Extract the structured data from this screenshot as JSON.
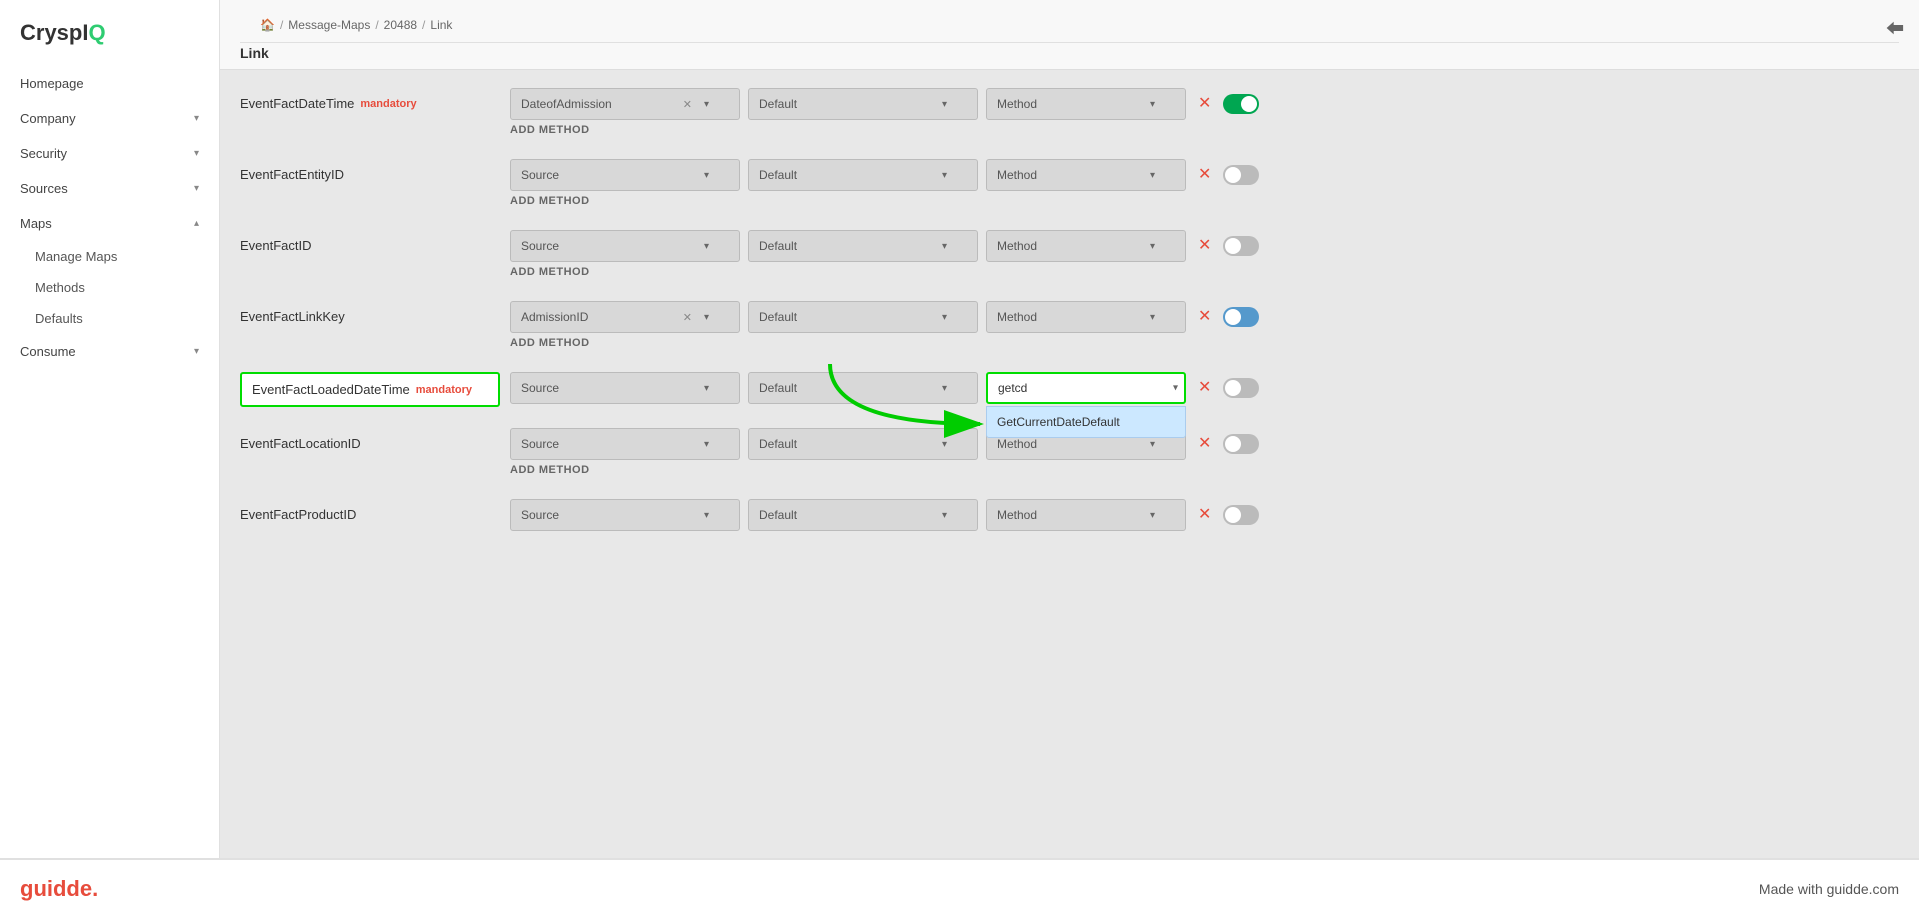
{
  "app": {
    "logo_crys": "CryspI",
    "logo_q": "Q",
    "logout_icon": "→"
  },
  "breadcrumb": {
    "home_icon": "🏠",
    "message_maps": "Message-Maps",
    "id": "20488",
    "current": "Link"
  },
  "page_title": "Link",
  "sidebar": {
    "items": [
      {
        "label": "Homepage",
        "has_children": false
      },
      {
        "label": "Company",
        "has_children": true
      },
      {
        "label": "Security",
        "has_children": true
      },
      {
        "label": "Sources",
        "has_children": true
      },
      {
        "label": "Maps",
        "has_children": true,
        "expanded": true
      },
      {
        "label": "Consume",
        "has_children": true
      }
    ],
    "sub_items": [
      {
        "label": "Manage Maps"
      },
      {
        "label": "Methods"
      },
      {
        "label": "Defaults"
      }
    ]
  },
  "rows": [
    {
      "id": "row1",
      "label": "EventFactDateTime",
      "mandatory": true,
      "source_value": "DateofAdmission",
      "source_has_clear": true,
      "default_value": "Default",
      "method_value": "Method",
      "toggle_active": true,
      "show_add_method": true
    },
    {
      "id": "row2",
      "label": "EventFactEntityID",
      "mandatory": false,
      "source_value": "Source",
      "source_has_clear": false,
      "default_value": "Default",
      "method_value": "Method",
      "toggle_active": false,
      "show_add_method": true
    },
    {
      "id": "row3",
      "label": "EventFactID",
      "mandatory": false,
      "source_value": "Source",
      "source_has_clear": false,
      "default_value": "Default",
      "method_value": "Method",
      "toggle_active": false,
      "show_add_method": true
    },
    {
      "id": "row4",
      "label": "EventFactLinkKey",
      "mandatory": false,
      "source_value": "AdmissionID",
      "source_has_clear": true,
      "default_value": "Default",
      "method_value": "Method",
      "toggle_active": false,
      "show_add_method": true
    },
    {
      "id": "row5",
      "label": "EventFactLoadedDateTime",
      "mandatory": true,
      "source_value": "Source",
      "source_has_clear": false,
      "default_value": "Default",
      "method_value": "",
      "method_input": "getcd",
      "toggle_active": false,
      "show_add_method": false,
      "highlighted": true,
      "dropdown_items": [
        "GetCurrentDateDefault"
      ]
    },
    {
      "id": "row6",
      "label": "EventFactLocationID",
      "mandatory": false,
      "source_value": "Source",
      "source_has_clear": false,
      "default_value": "Default",
      "method_value": "Method",
      "toggle_active": false,
      "show_add_method": true
    },
    {
      "id": "row7",
      "label": "EventFactProductID",
      "mandatory": false,
      "source_value": "Source",
      "source_has_clear": false,
      "default_value": "Default",
      "method_value": "Method",
      "toggle_active": false,
      "show_add_method": false
    }
  ],
  "labels": {
    "add_method": "ADD METHOD",
    "mandatory": "mandatory",
    "source_placeholder": "Source",
    "default_placeholder": "Default",
    "method_placeholder": "Method"
  },
  "footer": {
    "logo": "guidde.",
    "tagline": "Made with guidde.com"
  }
}
